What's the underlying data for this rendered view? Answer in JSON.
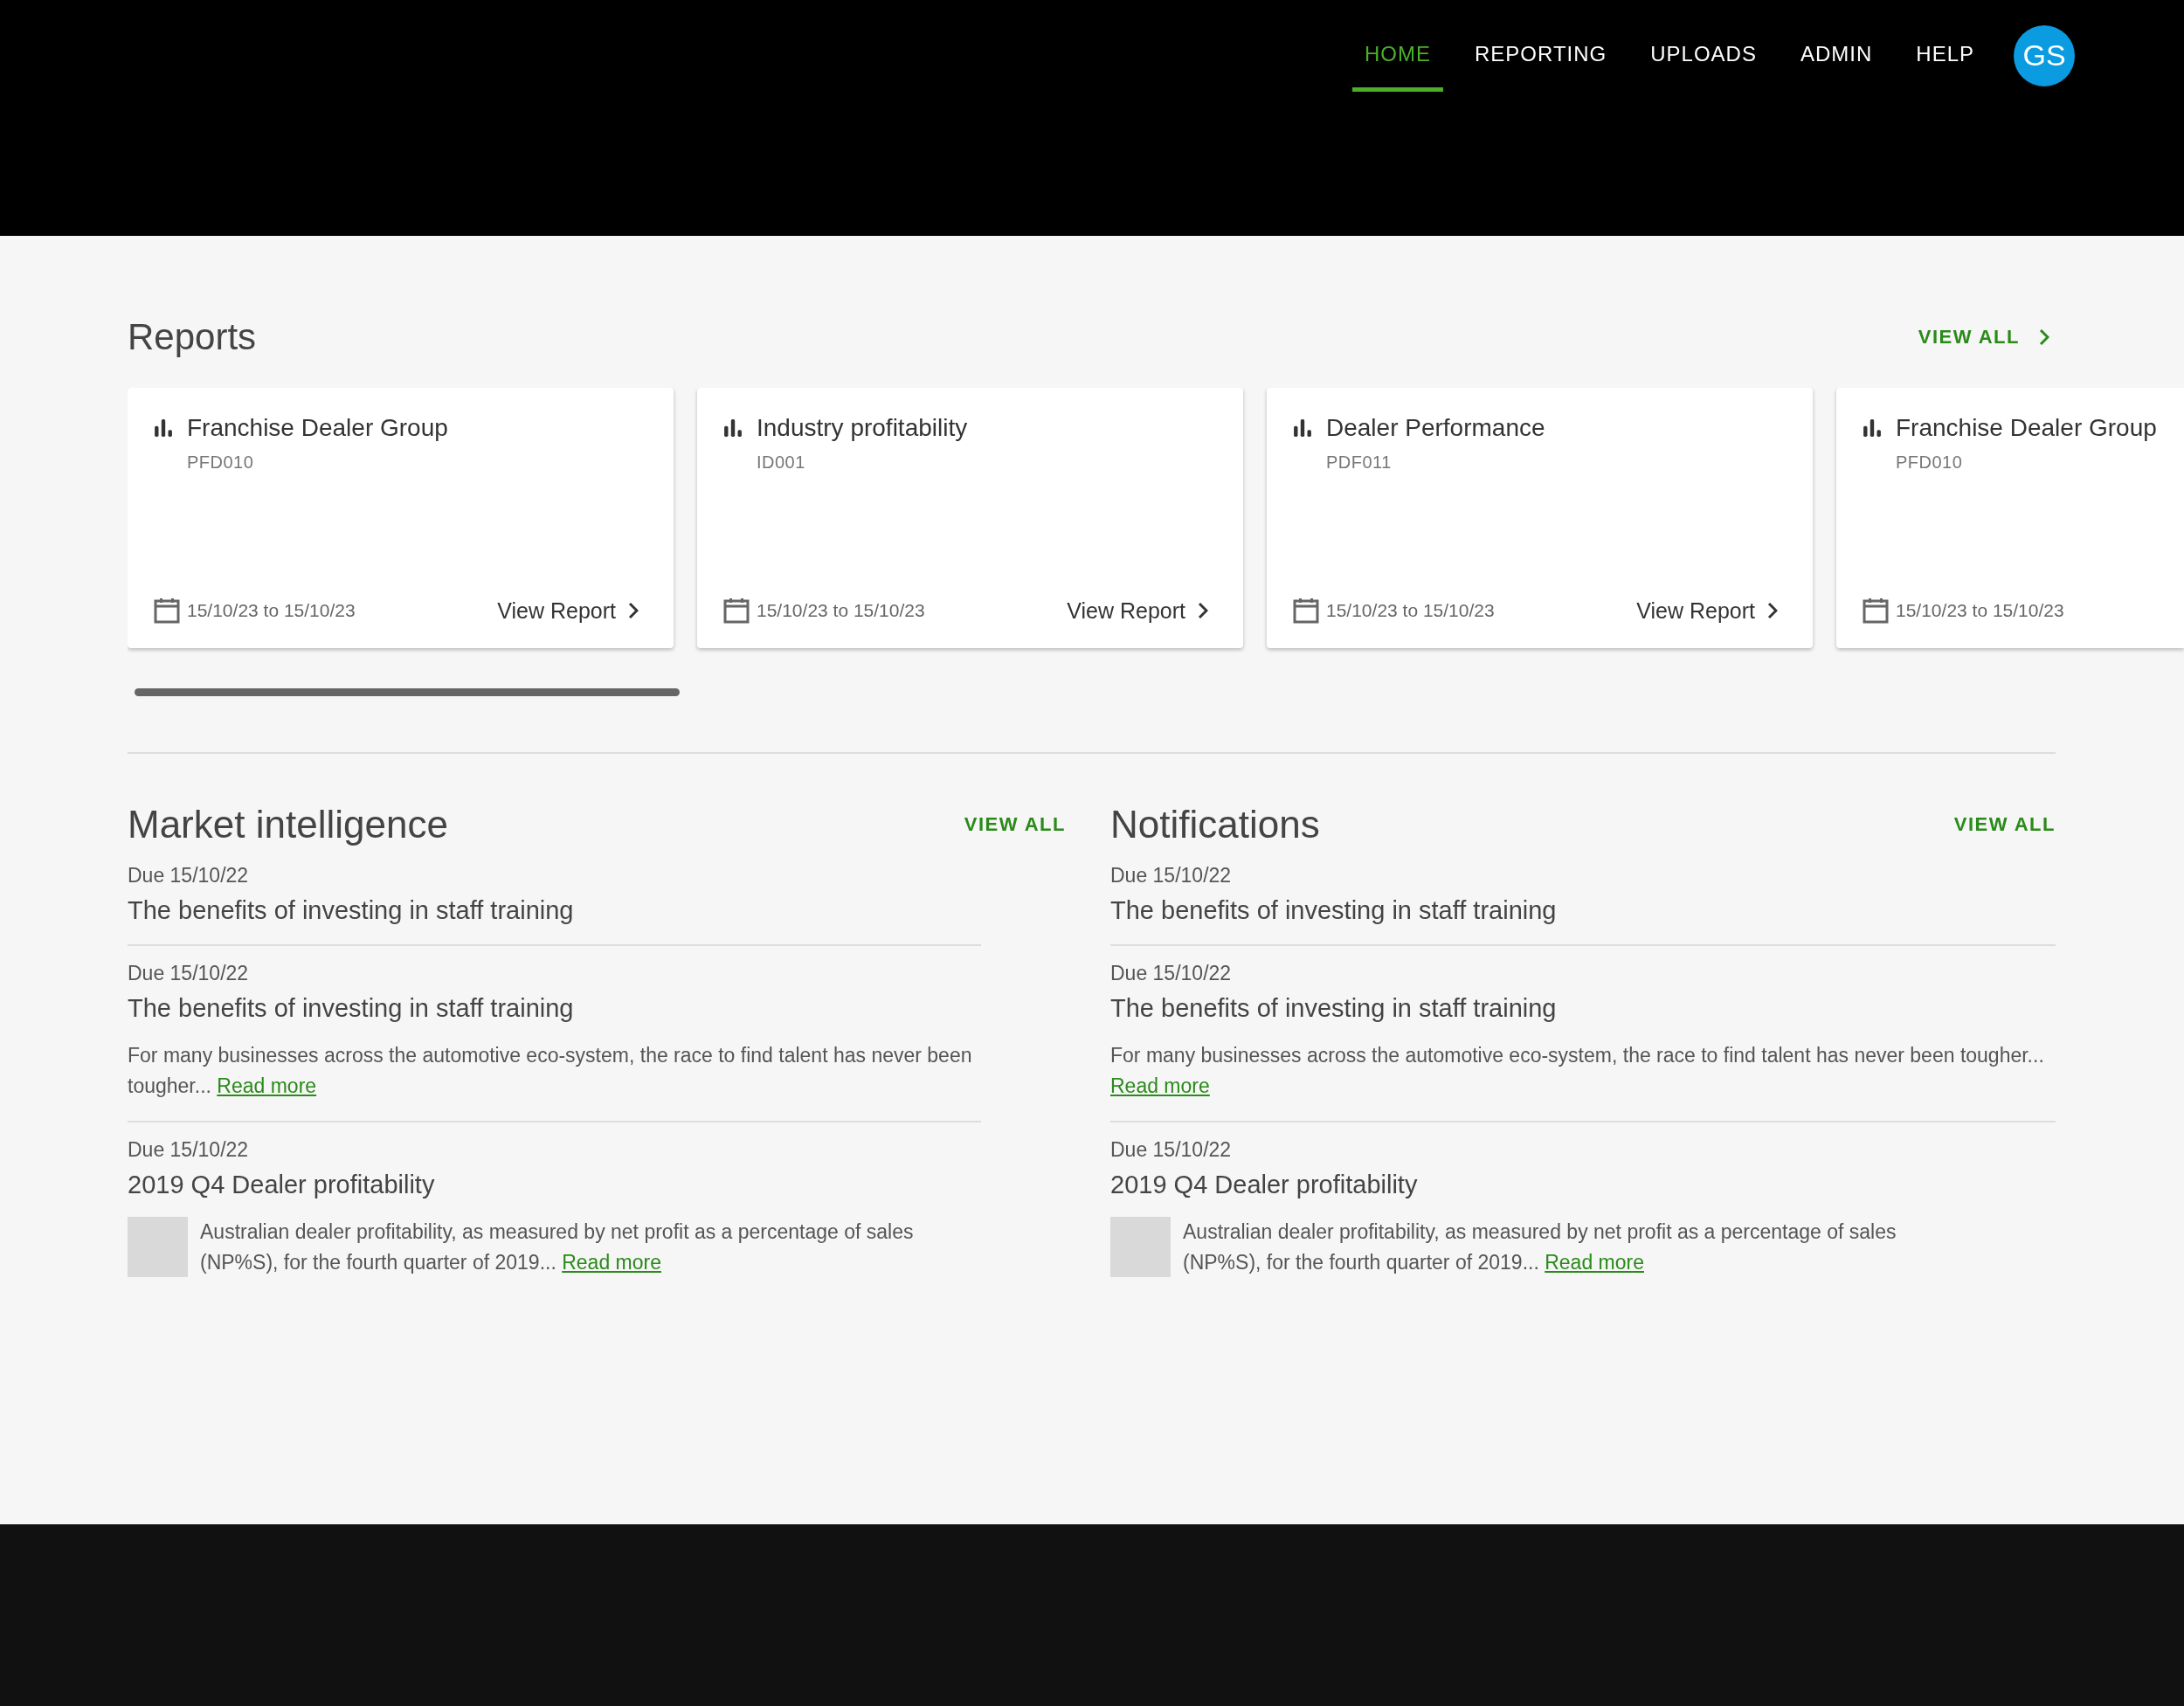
{
  "nav": {
    "items": [
      {
        "label": "HOME",
        "selected": true
      },
      {
        "label": "REPORTING",
        "selected": false
      },
      {
        "label": "UPLOADS",
        "selected": false
      },
      {
        "label": "ADMIN",
        "selected": false
      },
      {
        "label": "HELP",
        "selected": false
      }
    ],
    "avatar": "GS"
  },
  "reports": {
    "title": "Reports",
    "view_all": "VIEW ALL",
    "cards": [
      {
        "title": "Franchise Dealer Group",
        "code": "PFD010",
        "dates": "15/10/23 to 15/10/23",
        "view_report": "View Report"
      },
      {
        "title": "Industry profitability",
        "code": "ID001",
        "dates": "15/10/23 to 15/10/23",
        "view_report": "View Report"
      },
      {
        "title": "Dealer Performance",
        "code": "PDF011",
        "dates": "15/10/23 to 15/10/23",
        "view_report": "View Report"
      },
      {
        "title": "Franchise Dealer Group",
        "code": "PFD010",
        "dates": "15/10/23 to 15/10/23"
      }
    ]
  },
  "sections": [
    {
      "title": "Market intelligence",
      "view_all": "VIEW ALL",
      "items": [
        {
          "kind": "plain",
          "due": "Due 15/10/22",
          "title": "The benefits of investing in staff training"
        },
        {
          "kind": "text",
          "due": "Due 15/10/22",
          "title": "The benefits of investing in staff training",
          "body": "For many businesses across the automotive eco-system, the race to find talent has never been tougher...",
          "link": "Read more"
        },
        {
          "kind": "thumb",
          "due": "Due 15/10/22",
          "title": "2019 Q4 Dealer profitability",
          "body": "Australian dealer profitability, as measured by net profit as a percentage of sales (NP%S), for the fourth quarter of 2019...",
          "link": "Read more"
        }
      ]
    },
    {
      "title": "Notifications",
      "view_all": "VIEW ALL",
      "items": [
        {
          "kind": "plain",
          "due": "Due 15/10/22",
          "title": "The benefits of investing in staff training"
        },
        {
          "kind": "text",
          "due": "Due 15/10/22",
          "title": "The benefits of investing in staff training",
          "body": "For many businesses across the automotive eco-system, the race to find talent has never been tougher...",
          "link": "Read more"
        },
        {
          "kind": "thumb",
          "due": "Due 15/10/22",
          "title": "2019 Q4 Dealer profitability",
          "body": "Australian dealer profitability, as measured by net profit as a percentage of sales (NP%S), for the fourth quarter of 2019...",
          "link": "Read more"
        }
      ]
    }
  ]
}
